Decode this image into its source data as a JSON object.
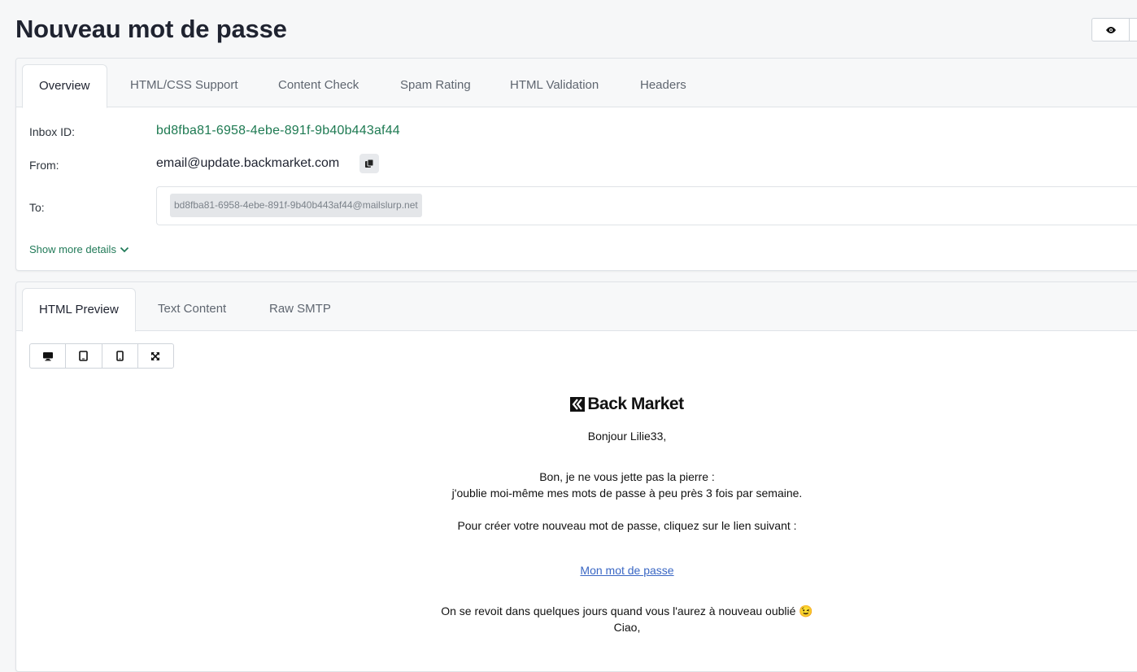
{
  "page": {
    "title": "Nouveau mot de passe"
  },
  "top_actions": {
    "icons": [
      "eye-icon"
    ]
  },
  "overview_tabs": [
    {
      "label": "Overview",
      "active": true
    },
    {
      "label": "HTML/CSS Support"
    },
    {
      "label": "Content Check"
    },
    {
      "label": "Spam Rating"
    },
    {
      "label": "HTML Validation"
    },
    {
      "label": "Headers"
    }
  ],
  "details": {
    "inbox_label": "Inbox ID:",
    "inbox_id": "bd8fba81-6958-4ebe-891f-9b40b443af44",
    "from_label": "From:",
    "from": "email@update.backmarket.com",
    "to_label": "To:",
    "to": "bd8fba81-6958-4ebe-891f-9b40b443af44@mailslurp.net",
    "show_more": "Show more details"
  },
  "preview_tabs": [
    {
      "label": "HTML Preview",
      "active": true
    },
    {
      "label": "Text Content"
    },
    {
      "label": "Raw SMTP"
    }
  ],
  "device_buttons": [
    "desktop-icon",
    "tablet-icon",
    "mobile-icon",
    "fullscreen-icon"
  ],
  "email": {
    "logo_text": "Back Market",
    "greeting": "Bonjour Lilie33,",
    "line1": "Bon, je ne vous jette pas la pierre :",
    "line2": "j'oublie moi-même mes mots de passe à peu près 3 fois par semaine.",
    "line3": "Pour créer votre nouveau mot de passe, cliquez sur le lien suivant :",
    "link": "Mon mot de passe",
    "line4": "On se revoit dans quelques jours quand vous l'aurez à nouveau oublié 😉",
    "line5": "Ciao,"
  },
  "colors": {
    "accent_green": "#1e7a52",
    "link_blue": "#3a67c4"
  }
}
